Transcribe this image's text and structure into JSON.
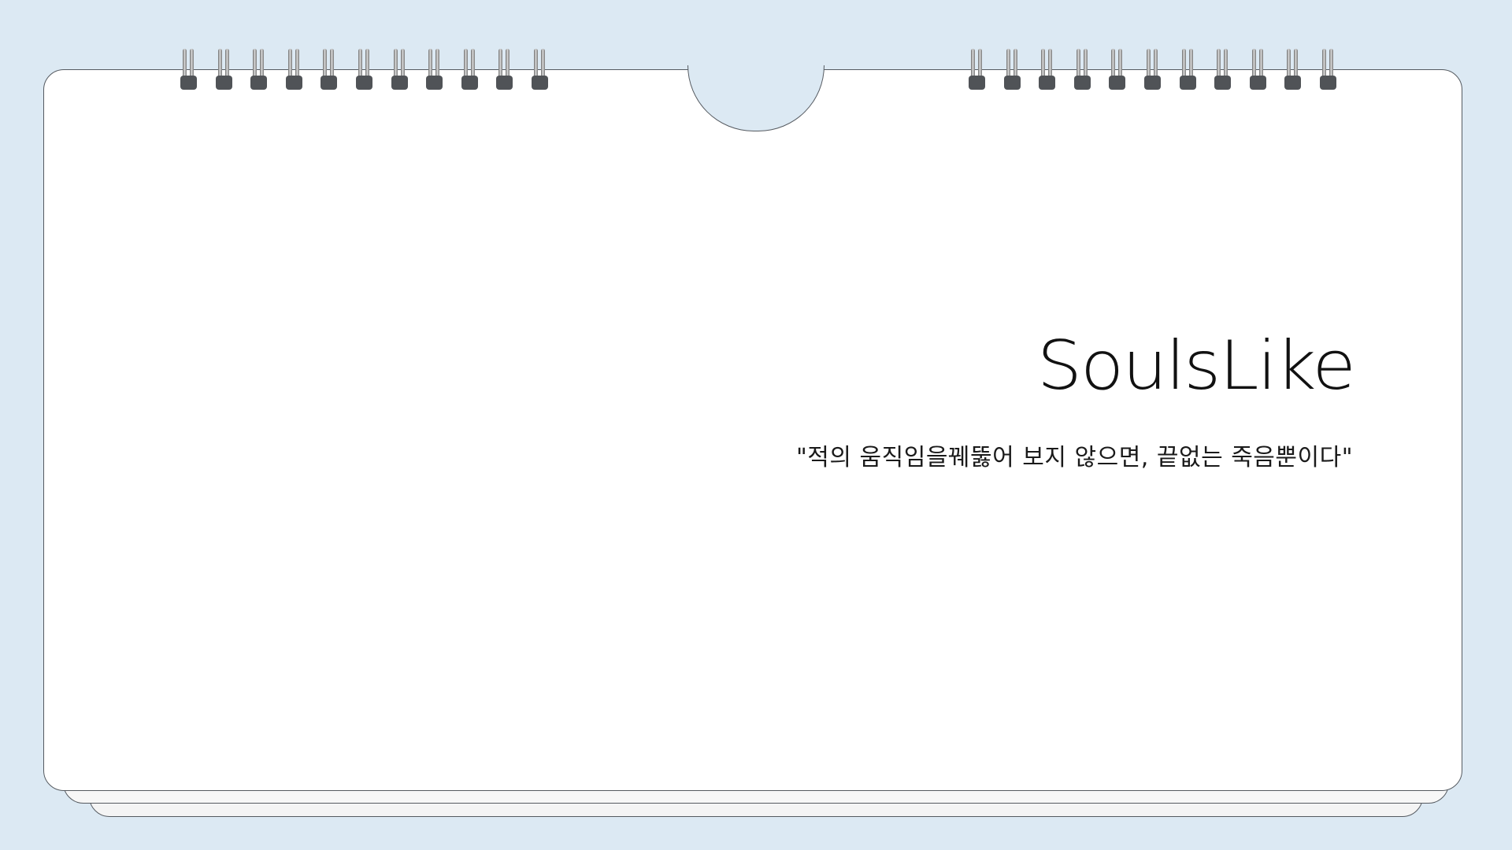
{
  "slide": {
    "title": "SoulsLike",
    "quote": "\"적의 움직임을꿰뚫어 보지 않으면, 끝없는 죽음뿐이다\""
  },
  "colors": {
    "background": "#dce9f3",
    "paper": "#ffffff",
    "outline": "#555a60",
    "ring_base": "#505357"
  },
  "icons": {
    "binding": "spiral-ring-icon"
  }
}
